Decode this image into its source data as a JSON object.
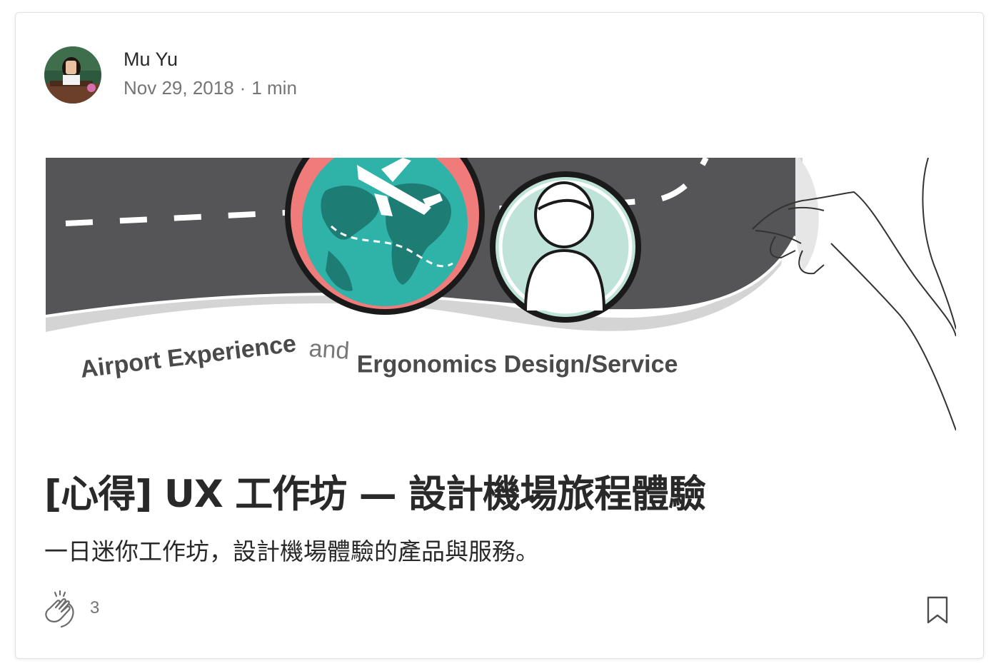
{
  "post": {
    "author": "Mu Yu",
    "date": "Nov 29, 2018",
    "separator": "·",
    "read_time": "1 min",
    "title": "[心得] UX 工作坊 — 設計機場旅程體驗",
    "subtitle": "一日迷你工作坊，設計機場體驗的產品與服務。",
    "clap_count": "3"
  },
  "hero": {
    "caption_part1": "Airport Experience",
    "caption_part2": "and",
    "caption_part3": "Ergonomics Design/Service"
  },
  "icons": {
    "clap": "clap-icon",
    "bookmark": "bookmark-icon"
  },
  "colors": {
    "road": "#555557",
    "globe_bg": "#f07b7b",
    "ocean": "#2fb2a7",
    "land": "#1d7c74",
    "person_bg": "#bfe3d8",
    "muted_text": "#757575"
  }
}
